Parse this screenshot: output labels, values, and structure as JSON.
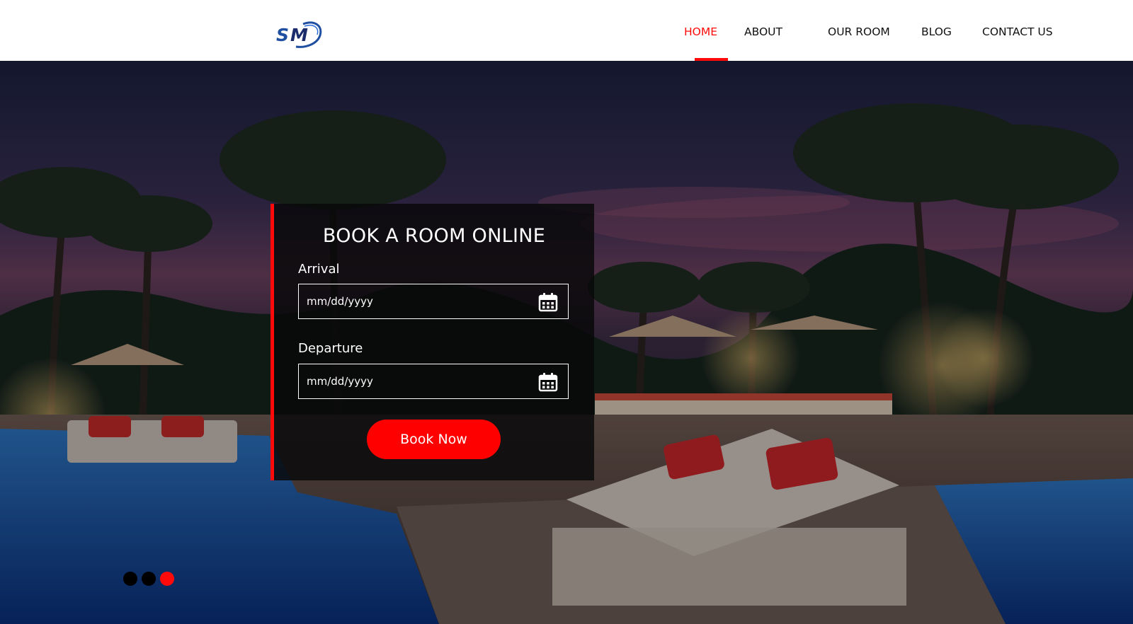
{
  "header": {
    "logo_alt": "SM",
    "nav": [
      {
        "label": "HOME",
        "active": true
      },
      {
        "label": "ABOUT",
        "active": false
      },
      {
        "label": "OUR ROOM",
        "active": false
      },
      {
        "label": "BLOG",
        "active": false
      },
      {
        "label": "CONTACT US",
        "active": false
      }
    ]
  },
  "booking": {
    "title": "BOOK A ROOM ONLINE",
    "arrival_label": "Arrival",
    "arrival_value": "mm/dd/yyyy",
    "departure_label": "Departure",
    "departure_value": "mm/dd/yyyy",
    "button_label": "Book Now",
    "calendar_icon": "calendar-icon"
  },
  "slider": {
    "dot_count": 3,
    "active_index": 2
  },
  "colors": {
    "accent": "#ff0a0a",
    "nav_text": "#111111",
    "dot_inactive": "#000000"
  }
}
